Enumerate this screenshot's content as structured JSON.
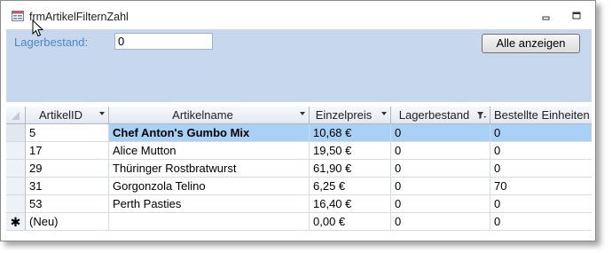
{
  "window": {
    "title": "frmArtikelFilternZahl"
  },
  "filter": {
    "label": "Lagerbestand:",
    "value": "0"
  },
  "buttons": {
    "show_all": "Alle anzeigen"
  },
  "grid": {
    "columns": [
      "ArtikelID",
      "Artikelname",
      "Einzelpreis",
      "Lagerbestand",
      "Bestellte Einheiten"
    ],
    "rows": [
      {
        "id": "5",
        "name": "Chef Anton's Gumbo Mix",
        "price": "10,68 €",
        "stock": "0",
        "ordered": "0"
      },
      {
        "id": "17",
        "name": "Alice Mutton",
        "price": "19,50 €",
        "stock": "0",
        "ordered": "0"
      },
      {
        "id": "29",
        "name": "Thüringer Rostbratwurst",
        "price": "61,90 €",
        "stock": "0",
        "ordered": "0"
      },
      {
        "id": "31",
        "name": "Gorgonzola Telino",
        "price": "6,25 €",
        "stock": "0",
        "ordered": "70"
      },
      {
        "id": "53",
        "name": "Perth Pasties",
        "price": "16,40 €",
        "stock": "0",
        "ordered": "0"
      }
    ],
    "new_row": {
      "id": "(Neu)",
      "price": "0,00 €",
      "stock": "0",
      "ordered": "0"
    }
  },
  "icons": {
    "form": "form-icon",
    "cursor": "mouse-pointer-icon",
    "minimize": "minimize-icon",
    "restore": "restore-icon",
    "filter": "filter-icon",
    "new_record": "new-record-star-icon"
  },
  "colors": {
    "header_bg": "#c7d8ee",
    "label": "#4d86c8",
    "selected_row": "#a9d0f5"
  }
}
